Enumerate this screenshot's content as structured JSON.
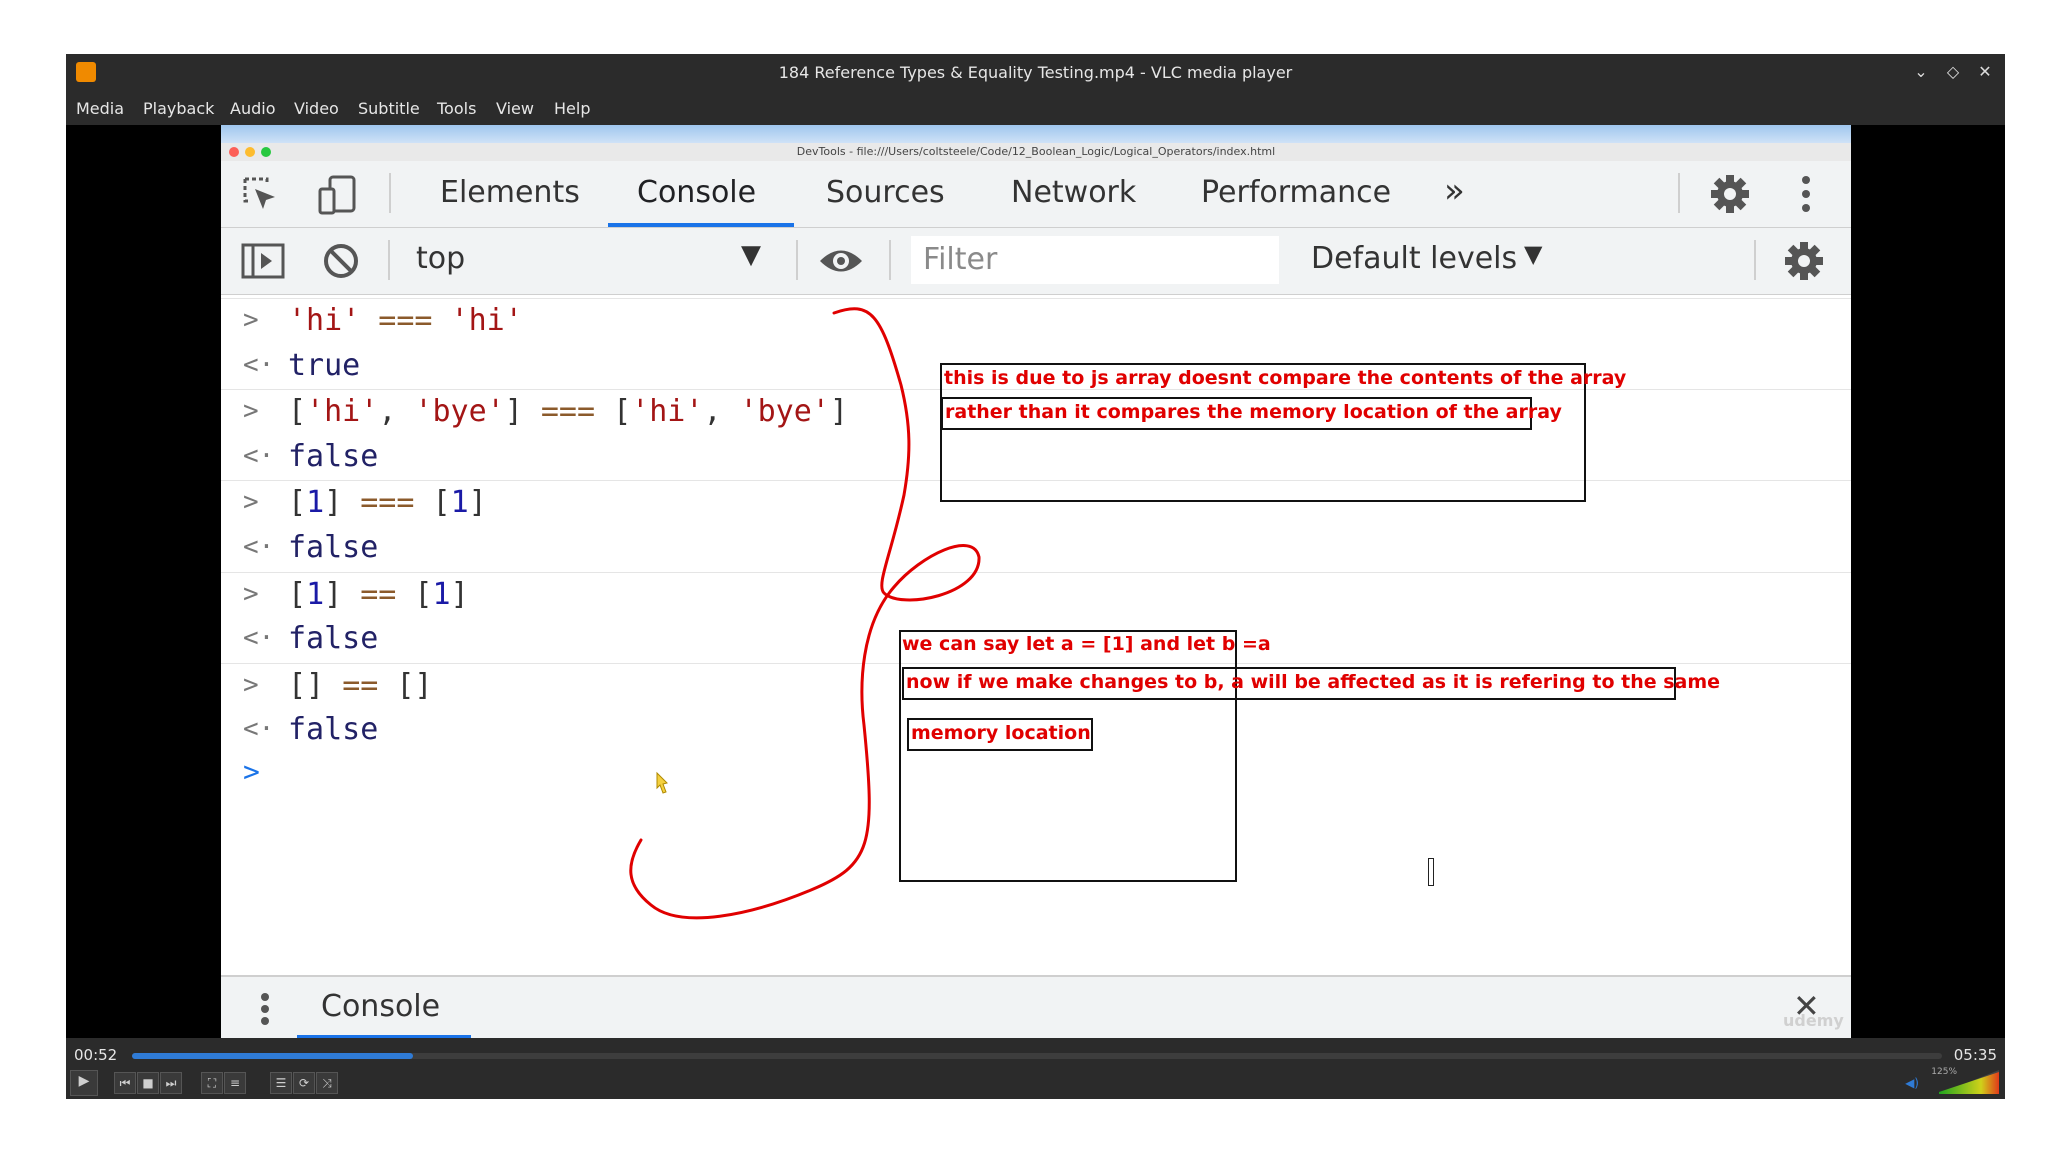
{
  "window": {
    "title": "184 Reference Types & Equality Testing.mp4 - VLC media player",
    "app_icon": "vlc-cone-icon"
  },
  "menubar": [
    "Media",
    "Playback",
    "Audio",
    "Video",
    "Subtitle",
    "Tools",
    "View",
    "Help"
  ],
  "devtools": {
    "title": "DevTools - file:///Users/coltsteele/Code/12_Boolean_Logic/Logical_Operators/index.html",
    "tabs": [
      "Elements",
      "Console",
      "Sources",
      "Network",
      "Performance"
    ],
    "active_tab": "Console",
    "more_tabs": "»",
    "context": "top",
    "filter_placeholder": "Filter",
    "levels": "Default levels",
    "drawer_tab": "Console",
    "accent_color": "#1a73e8"
  },
  "console": {
    "entries": [
      {
        "type": "input",
        "prefix": ">",
        "parts": [
          [
            "str",
            "'hi'"
          ],
          [
            "op",
            " === "
          ],
          [
            "str",
            "'hi'"
          ]
        ]
      },
      {
        "type": "output",
        "prefix": "<·",
        "parts": [
          [
            "kw",
            "true"
          ]
        ]
      },
      {
        "type": "input",
        "prefix": ">",
        "parts": [
          [
            "plain",
            "["
          ],
          [
            "str",
            "'hi'"
          ],
          [
            "plain",
            ", "
          ],
          [
            "str",
            "'bye'"
          ],
          [
            "plain",
            "] "
          ],
          [
            "op",
            "==="
          ],
          [
            "plain",
            " ["
          ],
          [
            "str",
            "'hi'"
          ],
          [
            "plain",
            ", "
          ],
          [
            "str",
            "'bye'"
          ],
          [
            "plain",
            "]"
          ]
        ]
      },
      {
        "type": "output",
        "prefix": "<·",
        "parts": [
          [
            "kw",
            "false"
          ]
        ]
      },
      {
        "type": "input",
        "prefix": ">",
        "parts": [
          [
            "plain",
            "["
          ],
          [
            "num",
            "1"
          ],
          [
            "plain",
            "] "
          ],
          [
            "op",
            "==="
          ],
          [
            "plain",
            " ["
          ],
          [
            "num",
            "1"
          ],
          [
            "plain",
            "]"
          ]
        ]
      },
      {
        "type": "output",
        "prefix": "<·",
        "parts": [
          [
            "kw",
            "false"
          ]
        ]
      },
      {
        "type": "input",
        "prefix": ">",
        "parts": [
          [
            "plain",
            "["
          ],
          [
            "num",
            "1"
          ],
          [
            "plain",
            "] "
          ],
          [
            "op",
            "=="
          ],
          [
            "plain",
            " ["
          ],
          [
            "num",
            "1"
          ],
          [
            "plain",
            "]"
          ]
        ]
      },
      {
        "type": "output",
        "prefix": "<·",
        "parts": [
          [
            "kw",
            "false"
          ]
        ]
      },
      {
        "type": "input",
        "prefix": ">",
        "parts": [
          [
            "plain",
            "[] "
          ],
          [
            "op",
            "=="
          ],
          [
            "plain",
            " []"
          ]
        ]
      },
      {
        "type": "output",
        "prefix": "<·",
        "parts": [
          [
            "kw",
            "false"
          ]
        ]
      }
    ],
    "prompt": ">"
  },
  "annotations": {
    "note1_line1": "this is due to js array doesnt compare the contents of the array",
    "note1_line2": "rather than it compares the memory location of the array",
    "note2_line1": "we can say let a = [1] and let b =a",
    "note2_line2": "now if we make changes to b, a will be affected as it is refering to the same",
    "note2_line3": "memory location",
    "ink_color": "#e00000"
  },
  "watermark": "udemy",
  "player": {
    "current_time": "00:52",
    "total_time": "05:35",
    "progress": 0.155,
    "volume_label": "125%"
  }
}
